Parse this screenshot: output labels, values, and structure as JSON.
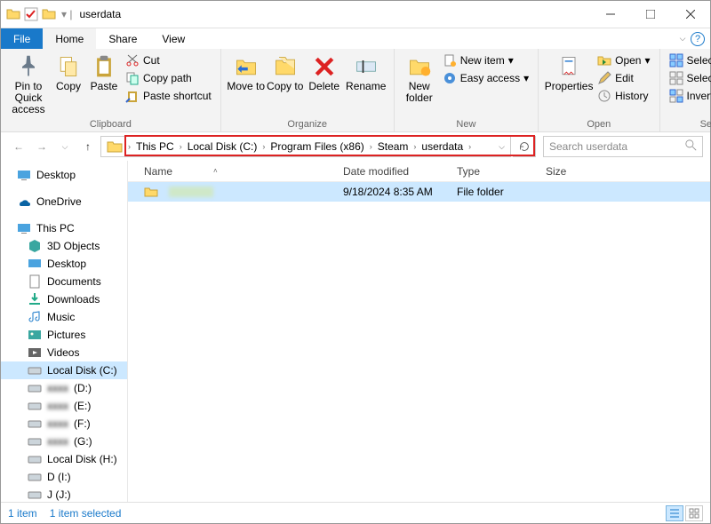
{
  "titlebar": {
    "title": "userdata"
  },
  "menu": {
    "file": "File",
    "home": "Home",
    "share": "Share",
    "view": "View"
  },
  "ribbon": {
    "pin": "Pin to Quick access",
    "copy": "Copy",
    "paste": "Paste",
    "cut": "Cut",
    "copy_path": "Copy path",
    "paste_shortcut": "Paste shortcut",
    "move_to": "Move to",
    "copy_to": "Copy to",
    "delete": "Delete",
    "rename": "Rename",
    "new_folder": "New folder",
    "new_item": "New item",
    "easy_access": "Easy access",
    "properties": "Properties",
    "open": "Open",
    "edit": "Edit",
    "history": "History",
    "select_all": "Select all",
    "select_none": "Select none",
    "invert_selection": "Invert selection",
    "groups": {
      "clipboard": "Clipboard",
      "organize": "Organize",
      "new": "New",
      "open": "Open",
      "select": "Select"
    }
  },
  "breadcrumbs": [
    "This PC",
    "Local Disk (C:)",
    "Program Files (x86)",
    "Steam",
    "userdata"
  ],
  "search_placeholder": "Search userdata",
  "columns": {
    "name": "Name",
    "date": "Date modified",
    "type": "Type",
    "size": "Size"
  },
  "rows": [
    {
      "name": "",
      "date": "9/18/2024 8:35 AM",
      "type": "File folder",
      "size": ""
    }
  ],
  "nav": {
    "desktop": "Desktop",
    "onedrive": "OneDrive",
    "this_pc": "This PC",
    "objects3d": "3D Objects",
    "desktop2": "Desktop",
    "documents": "Documents",
    "downloads": "Downloads",
    "music": "Music",
    "pictures": "Pictures",
    "videos": "Videos",
    "local_c": "Local Disk (C:)",
    "drive_d": "(D:)",
    "drive_e": "(E:)",
    "drive_f": "(F:)",
    "drive_g": "(G:)",
    "local_h": "Local Disk (H:)",
    "drive_i": "D (I:)",
    "drive_j": "J (J:)"
  },
  "status": {
    "items": "1 item",
    "selected": "1 item selected"
  }
}
